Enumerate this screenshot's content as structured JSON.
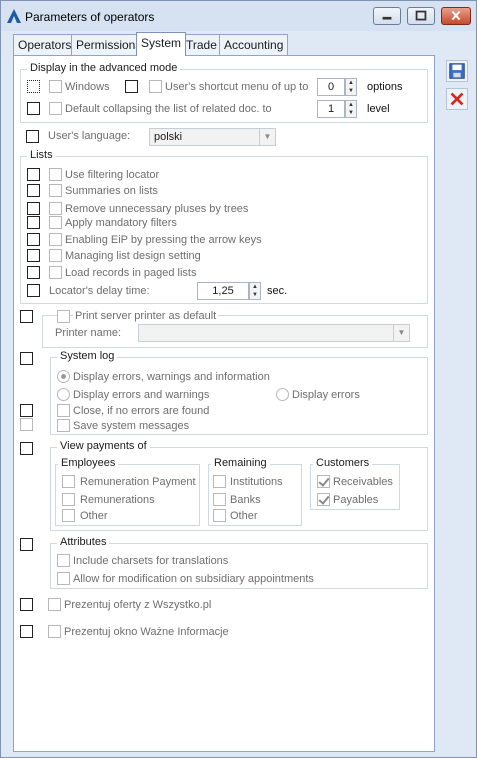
{
  "window": {
    "title": "Parameters of operators"
  },
  "tabs": [
    "Operators",
    "Permissions",
    "System",
    "Trade",
    "Accounting"
  ],
  "advanced": {
    "title": "Display in the advanced mode",
    "windows_label": "Windows",
    "shortcut_label": "User's shortcut menu of up to",
    "shortcut_value": "0",
    "shortcut_suffix": "options",
    "collapse_label": "Default collapsing the list of related doc. to",
    "collapse_value": "1",
    "collapse_suffix": "level"
  },
  "language": {
    "label": "User's language:",
    "value": "polski"
  },
  "lists": {
    "title": "Lists",
    "items": [
      "Use filtering locator",
      "Summaries on lists",
      "Remove unnecessary pluses by trees",
      "Apply mandatory filters",
      "Enabling EiP by pressing the arrow keys",
      "Managing list design setting",
      "Load records in paged lists"
    ],
    "delay_label": "Locator's delay time:",
    "delay_value": "1,25",
    "delay_unit": "sec."
  },
  "printer": {
    "default_label": "Print server printer as default",
    "name_label": "Printer name:",
    "name_value": ""
  },
  "system_log": {
    "title": "System log",
    "opt_all": "Display errors, warnings and information",
    "opt_errwarn": "Display errors and warnings",
    "opt_err": "Display errors",
    "close_label": "Close, if no errors are found",
    "save_label": "Save system messages"
  },
  "payments": {
    "title": "View payments of",
    "employees": {
      "title": "Employees",
      "items": [
        "Remuneration Payment",
        "Remunerations",
        "Other"
      ]
    },
    "remaining": {
      "title": "Remaining",
      "items": [
        "Institutions",
        "Banks",
        "Other"
      ]
    },
    "customers": {
      "title": "Customers",
      "items": [
        "Receivables",
        "Payables"
      ]
    }
  },
  "attributes": {
    "title": "Attributes",
    "charsets": "Include charsets for translations",
    "modification": "Allow for modification on subsidiary appointments"
  },
  "offers_label": "Prezentuj oferty z Wszystko.pl",
  "info_label": "Prezentuj okno Ważne Informacje",
  "icons": {
    "save": "save-icon",
    "cancel": "close-icon"
  },
  "colors": {
    "accent": "#1f5aa6",
    "cancel": "#d4291c"
  }
}
